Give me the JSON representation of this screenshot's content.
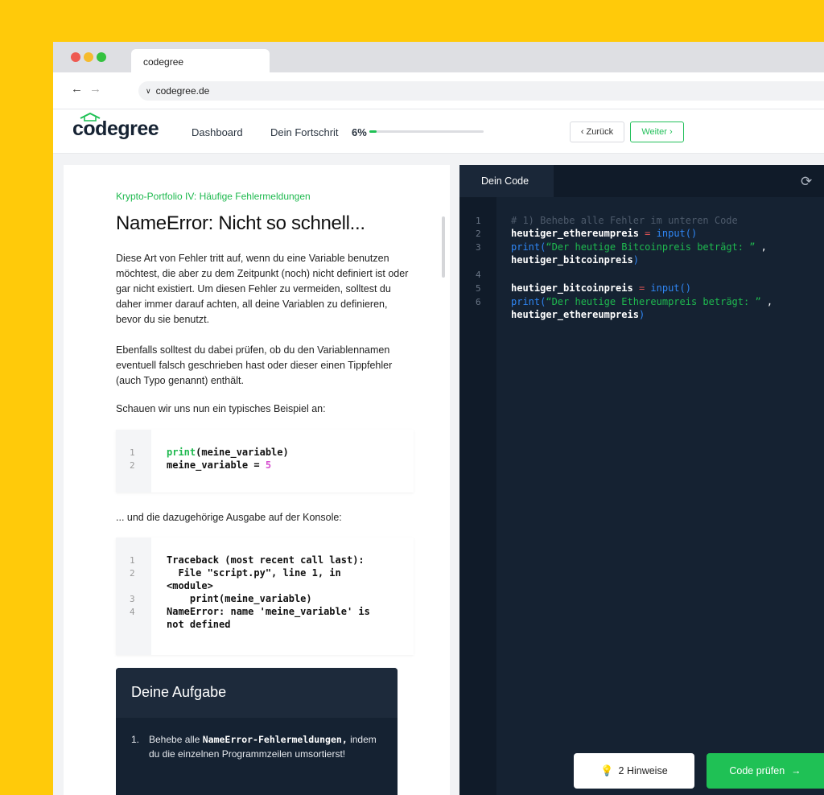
{
  "browser": {
    "tab_title": "codegree",
    "url": "codegree.de",
    "back_glyph": "←",
    "forward_glyph": "→",
    "url_chevron": "∨"
  },
  "header": {
    "logo": "codegree",
    "nav_dashboard": "Dashboard",
    "nav_progress": "Dein Fortschrit",
    "progress_percent_text": "6%",
    "progress_value": 0.06,
    "back_button": "‹ Zurück",
    "next_button": "Weiter ›"
  },
  "lesson": {
    "subtitle": "Krypto-Portfolio IV: Häufige Fehlermeldungen",
    "title": "NameError: Nicht so schnell...",
    "paragraphs": [
      "Diese Art von Fehler tritt auf, wenn du eine Variable benutzen möchtest, die aber zu dem Zeitpunkt (noch) nicht definiert ist oder gar nicht existiert. Um diesen Fehler zu vermeiden, solltest du daher immer darauf achten, all deine Variablen zu definieren, bevor du sie benutzt.",
      "Ebenfalls solltest du dabei prüfen, ob du den Variablennamen eventuell falsch geschrieben hast oder dieser einen Tippfehler (auch Typo genannt) enthält.",
      "Schauen wir uns nun ein typisches Beispiel an:",
      "... und die dazugehörige Ausgabe auf der Konsole:"
    ],
    "example_code": {
      "line_numbers": [
        "1",
        "2"
      ],
      "line1_keyword": "print",
      "line1_rest": "(meine_variable)",
      "line2_rest": "meine_variable = ",
      "line2_number": "5"
    },
    "console_output": {
      "line_numbers": [
        "1",
        "2",
        "3",
        "4"
      ],
      "lines": [
        "Traceback (most recent call last):",
        "  File \"script.py\", line 1, in",
        "<module>",
        "    print(meine_variable)",
        "NameError: name 'meine_variable' is",
        "not defined"
      ]
    },
    "task": {
      "heading": "Deine Aufgabe",
      "item_number": "1.",
      "item_prefix": "Behebe alle ",
      "item_bold": "NameError-Fehlermeldungen,",
      "item_suffix": " indem du die einzelnen Programmzeilen umsortierst!"
    }
  },
  "editor": {
    "tab": "Dein Code",
    "refresh_icon": "refresh-icon",
    "line_numbers": [
      "1",
      "2",
      "3",
      "4",
      "5",
      "6"
    ],
    "comment": "# 1) Behebe alle Fehler im unteren Code",
    "l2_var": "heutiger_ethereumpreis",
    "l2_op": " = ",
    "l2_fn": "input()",
    "l3_fn": "print(",
    "l3_str": "“Der heutige Bitcoinpreis beträgt: ”",
    "l3_comma": " ,",
    "l3b_var": "heutiger_bitcoinpreis",
    "l3b_close": ")",
    "l5_var": "heutiger_bitcoinpreis",
    "l5_op": " = ",
    "l5_fn": "input()",
    "l6_fn": "print(",
    "l6_str": "“Der heutige Ethereumpreis beträgt: ”",
    "l6_comma": " ,",
    "l6b_var": "heutiger_ethereumpreis",
    "l6b_close": ")",
    "hints_button": "2 Hinweise",
    "check_button": "Code prüfen",
    "bulb_glyph": "💡",
    "arrow_glyph": "→"
  },
  "colors": {
    "background": "#FFCA0A",
    "accent_green": "#1FC155",
    "dark_navy": "#152232",
    "function_blue": "#2F86F4",
    "operator_red": "#E05555"
  }
}
